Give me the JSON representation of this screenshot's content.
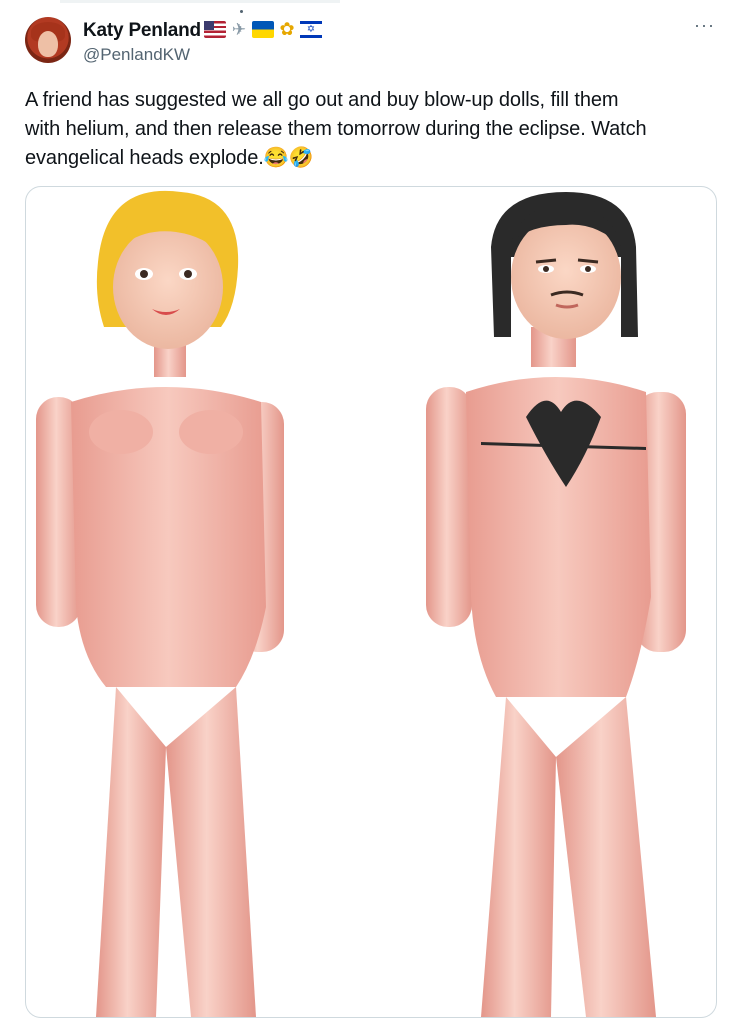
{
  "tweet": {
    "display_name": "Katy Penland",
    "name_icons": [
      "us-flag",
      "airplane",
      "ukraine-flag",
      "sunflower",
      "israel-flag"
    ],
    "handle": "@PenlandKW",
    "more_label": "···",
    "text": "A friend has suggested we all go out and buy blow-up dolls, fill them\nwith helium, and then release them tomorrow during the eclipse. Watch\nevangelical heads explode.😂🤣"
  },
  "media": {
    "content": "inflatable-dolls-photo"
  },
  "colors": {
    "text": "#0f1419",
    "secondary": "#536471",
    "border": "#cfd9de",
    "doll_skin": "#f2b7ac",
    "doll_hair_blonde": "#f2c02a",
    "doll_hair_dark": "#2a2a2a"
  }
}
